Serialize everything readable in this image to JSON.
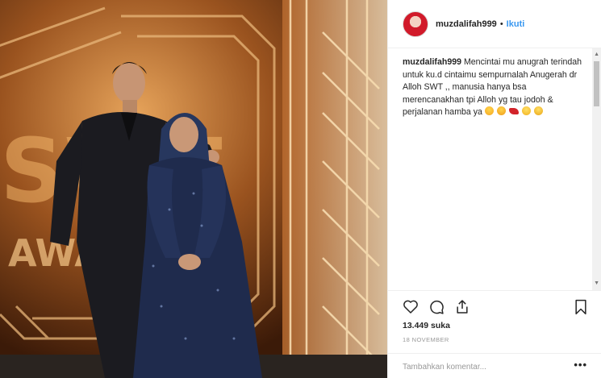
{
  "post": {
    "username": "muzdalifah999",
    "separator": "•",
    "follow_label": "Ikuti",
    "caption_user": "muzdalifah999",
    "caption_text": "Mencintai mu anugrah terindah untuk ku.d cintaimu sempurnalah Anugerah dr Alloh SWT ,, manusia hanya bsa merencanakhan tpi Alloh yg tau jodoh & perjalanan hamba ya",
    "caption_emojis": [
      "face-kiss-emoji",
      "face-kiss-emoji",
      "kiss-lips-emoji",
      "smile-emoji",
      "smile-emoji"
    ],
    "likes": "13.449 suka",
    "date": "18 NOVEMBER",
    "comment_placeholder": "Tambahkan komentar...",
    "more_label": "•••"
  },
  "photo": {
    "backdrop_text": "SWT AWAR",
    "description_icon": "photo"
  },
  "colors": {
    "accent": "#3897f0",
    "text": "#262626",
    "muted": "#999999",
    "border": "#efefef"
  }
}
